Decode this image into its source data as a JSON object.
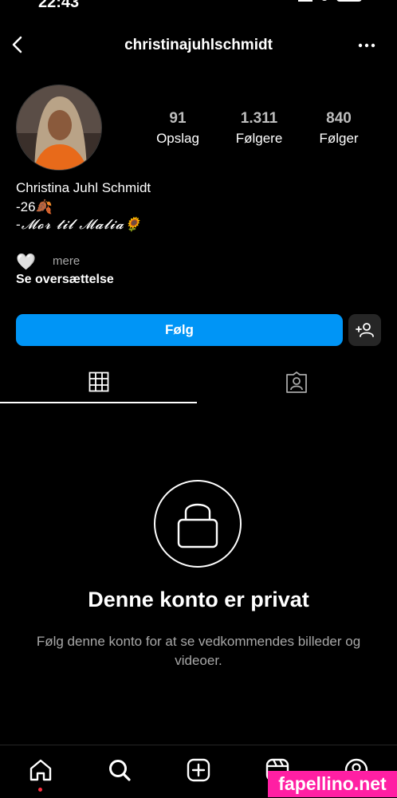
{
  "status_bar": {
    "time": "22:43"
  },
  "header": {
    "username": "christinajuhlschmidt"
  },
  "stats": [
    {
      "value": "91",
      "label": "Opslag"
    },
    {
      "value": "1.311",
      "label": "Følgere"
    },
    {
      "value": "840",
      "label": "Følger"
    }
  ],
  "bio": {
    "name": "Christina Juhl Schmidt",
    "line1": "-26🍂",
    "line2": "-𝓜𝓸𝓻 𝓽𝓲𝓵 𝓜𝓪𝓵𝓲𝓪🌻",
    "heart": "🤍",
    "more": "mere",
    "translate": "Se oversættelse"
  },
  "actions": {
    "follow_label": "Følg"
  },
  "private": {
    "title": "Denne konto er privat",
    "description": "Følg denne konto for at se vedkommendes billeder og videoer."
  },
  "watermark": "fapellino.net",
  "colors": {
    "accent": "#0095f6",
    "background": "#000000",
    "secondary_button": "#262626",
    "notification_dot": "#ff3040",
    "watermark": "#ff1fa3"
  },
  "icons": {
    "back": "back-arrow-icon",
    "more": "more-dots-icon",
    "grid": "grid-icon",
    "tagged": "tagged-person-icon",
    "lock": "lock-icon",
    "home": "home-icon",
    "search": "search-icon",
    "create": "create-icon",
    "reels": "reels-icon",
    "profile": "profile-icon",
    "suggest": "add-person-icon"
  }
}
